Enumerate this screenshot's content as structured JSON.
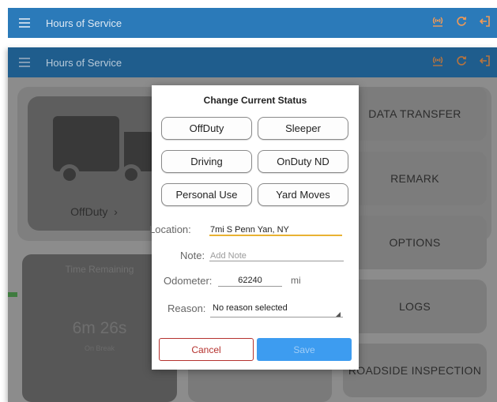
{
  "app": {
    "title": "Hours of Service",
    "header_icons": [
      "menu-icon",
      "connection-icon",
      "refresh-icon",
      "logout-icon"
    ]
  },
  "status_card": {
    "current_status": "OffDuty",
    "chevron": "›"
  },
  "side_buttons": [
    "DATA TRANSFER",
    "REMARK",
    "OPTIONS",
    "LOGS",
    "ROADSIDE INSPECTION"
  ],
  "timer": {
    "label": "Time Remaining",
    "value": "6m 26s",
    "sub": "On Break"
  },
  "dialog": {
    "title": "Change Current Status",
    "options": [
      "OffDuty",
      "Sleeper",
      "Driving",
      "OnDuty ND",
      "Personal Use",
      "Yard Moves"
    ],
    "location_label": "Location:",
    "location_value": "7mi S Penn Yan, NY",
    "note_label": "Note:",
    "note_placeholder": "Add Note",
    "odometer_label": "Odometer:",
    "odometer_value": "62240",
    "odometer_unit": "mi",
    "reason_label": "Reason:",
    "reason_value": "No reason selected",
    "cancel_label": "Cancel",
    "save_label": "Save"
  },
  "colors": {
    "header_blue": "#2b7ab9",
    "header_icon_orange": "#f29a55",
    "save_blue": "#3d9cf0",
    "cancel_red": "#b5322e",
    "location_underline": "#e9b233"
  }
}
